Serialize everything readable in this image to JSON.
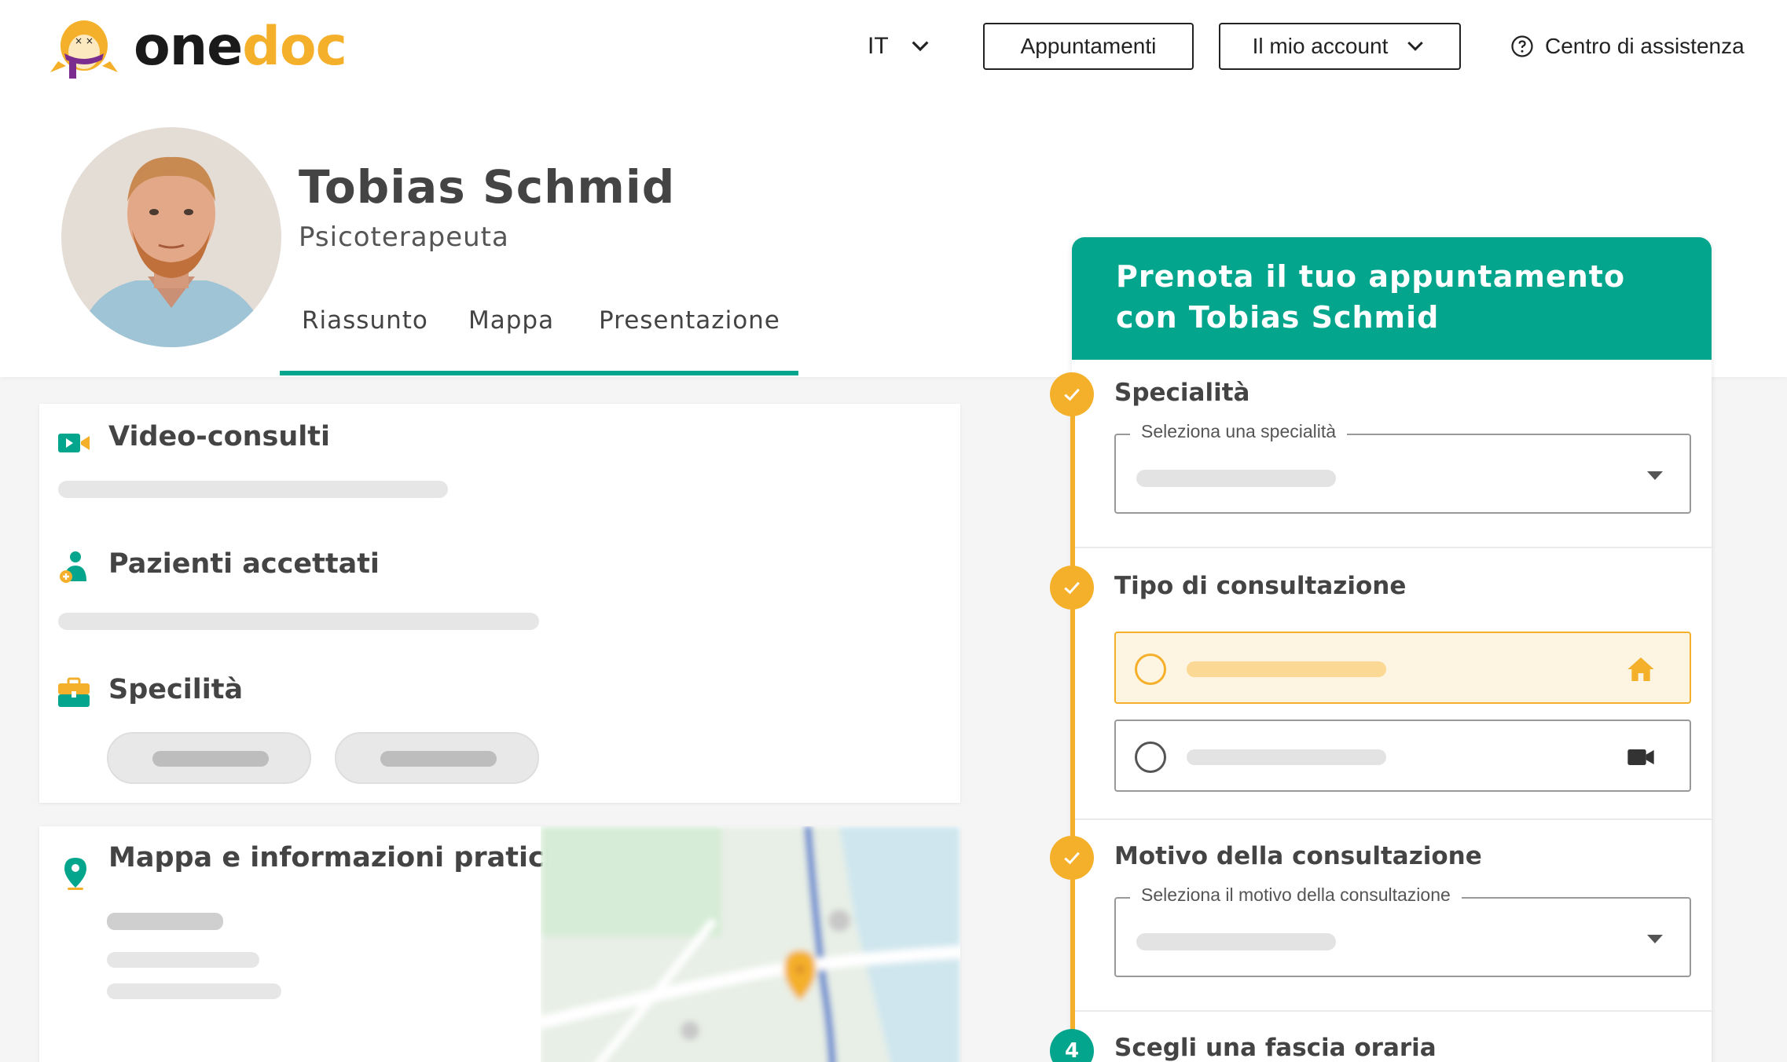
{
  "brand": {
    "name_part1": "one",
    "name_part2": "doc",
    "colors": {
      "green": "#03a58d",
      "orange": "#f4b02a",
      "dark": "#1a1a1a"
    }
  },
  "nav": {
    "language": "IT",
    "appointments": "Appuntamenti",
    "my_account": "Il mio account",
    "help_center": "Centro di assistenza"
  },
  "profile": {
    "name": "Tobias Schmid",
    "profession": "Psicoterapeuta",
    "tabs": [
      {
        "label": "Riassunto"
      },
      {
        "label": "Mappa"
      },
      {
        "label": "Presentazione"
      }
    ]
  },
  "info_card": {
    "sections": [
      {
        "title": "Video-consulti",
        "icon": "video-camera-icon"
      },
      {
        "title": "Pazienti accettati",
        "icon": "patient-icon"
      },
      {
        "title": "Specilità",
        "icon": "briefcase-icon"
      }
    ]
  },
  "map_card": {
    "title": "Mappa e informazioni pratiche",
    "icon": "location-pin-icon"
  },
  "booking": {
    "title": "Prenota il tuo appuntamento con Tobias Schmid",
    "steps": [
      {
        "title": "Specialità",
        "status": "done",
        "field_label": "Seleziona una specialità"
      },
      {
        "title": "Tipo di consultazione",
        "status": "done",
        "options": [
          {
            "icon": "home-icon",
            "selected": true
          },
          {
            "icon": "video-camera-icon",
            "selected": false
          }
        ]
      },
      {
        "title": "Motivo della consultazione",
        "status": "done",
        "field_label": "Seleziona il motivo della consultazione"
      },
      {
        "title": "Scegli una fascia oraria",
        "status": "current",
        "number": "4"
      }
    ]
  }
}
